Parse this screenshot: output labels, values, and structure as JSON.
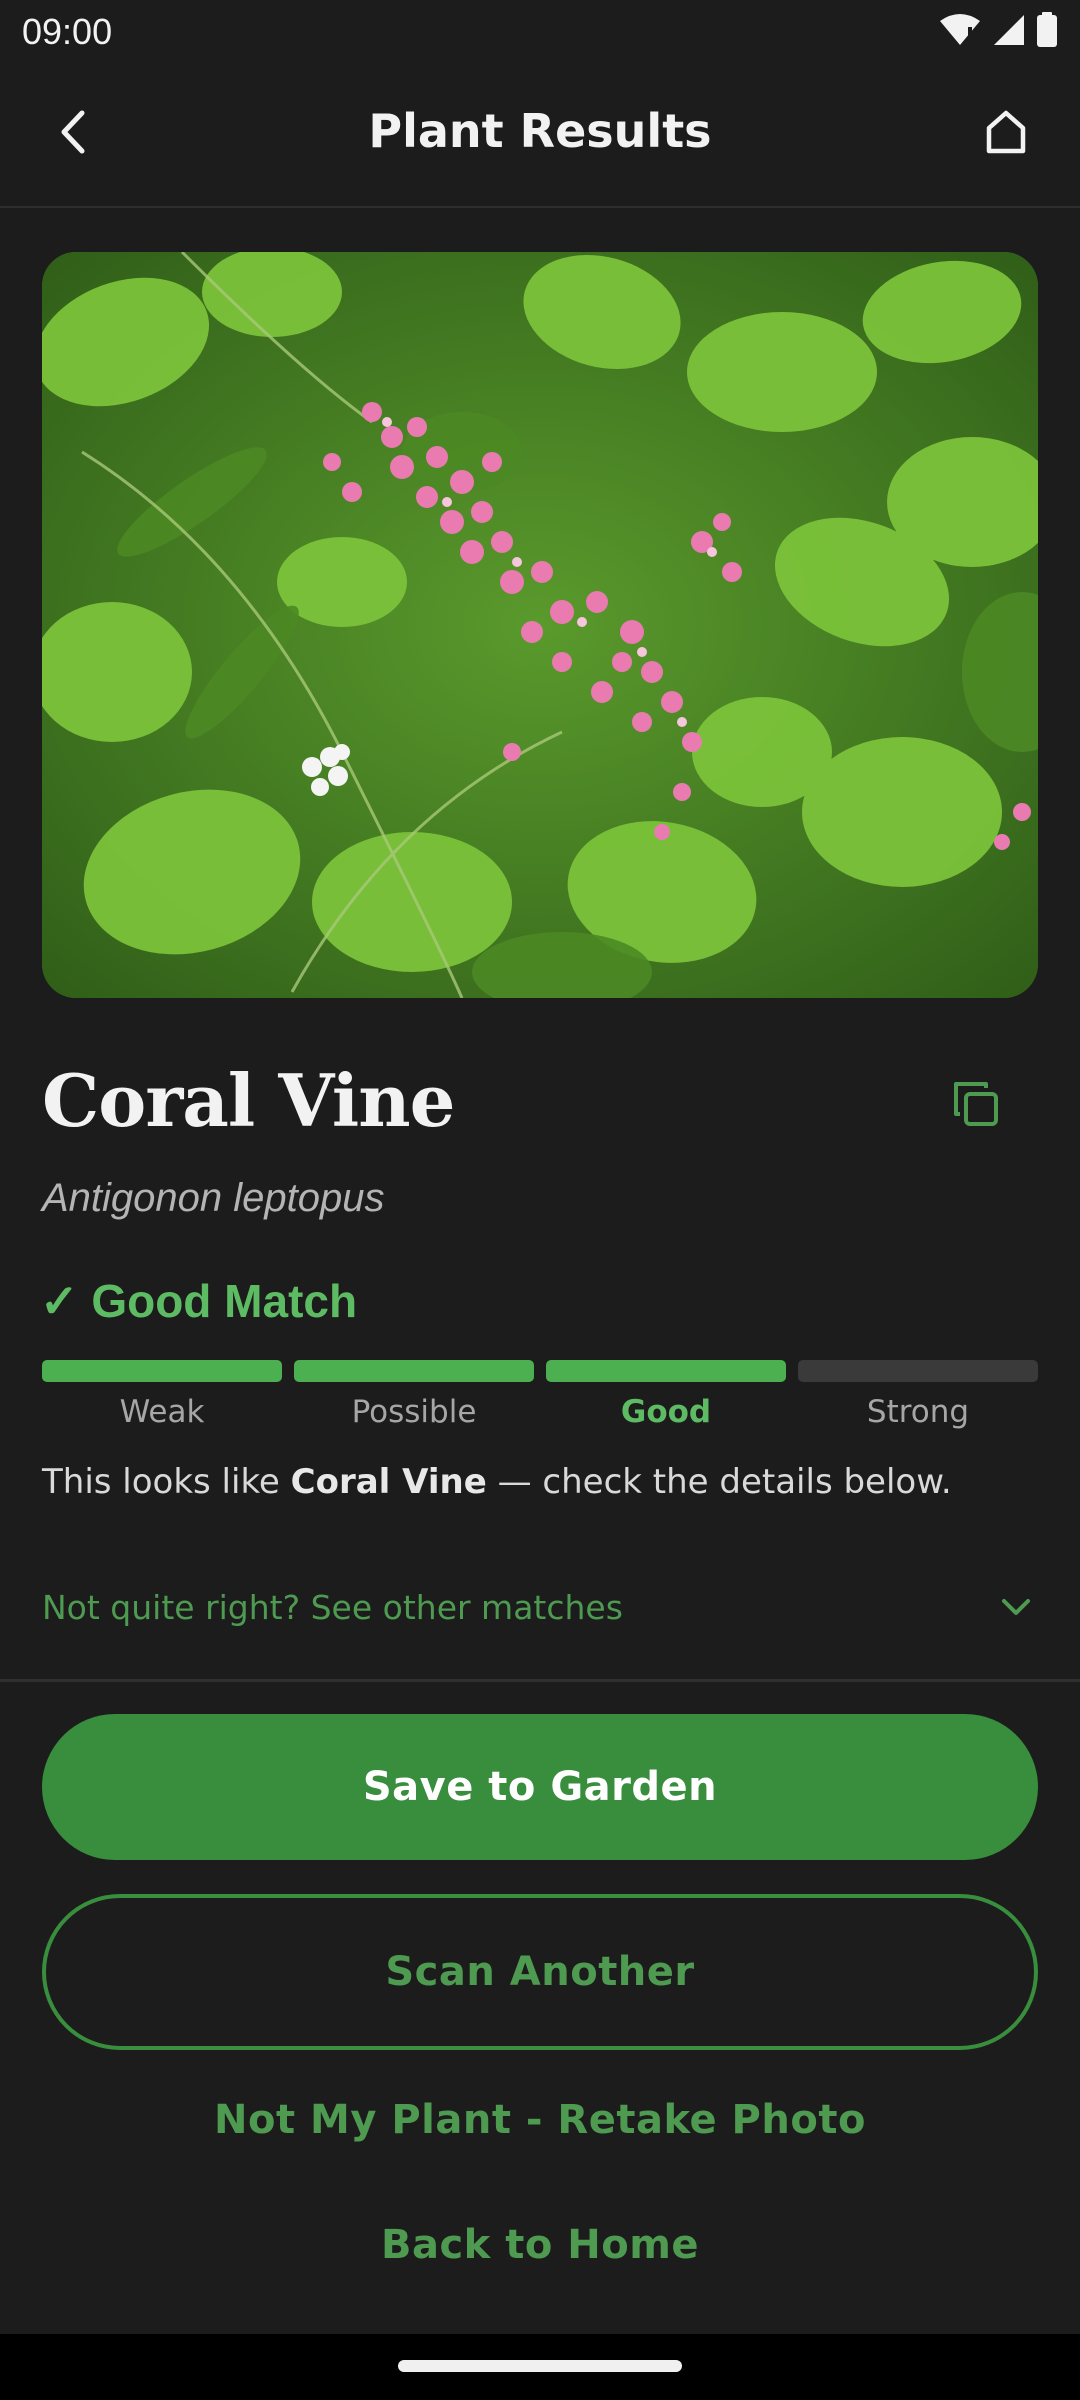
{
  "status_bar": {
    "time": "09:00",
    "icons": [
      "wifi-icon",
      "cell-signal-icon",
      "battery-icon"
    ]
  },
  "app_bar": {
    "title": "Plant Results",
    "back_icon": "chevron-left-icon",
    "home_icon": "home-icon"
  },
  "plant": {
    "common_name": "Coral Vine",
    "scientific_name": "Antigonon leptopus",
    "copy_icon": "copy-icon"
  },
  "match": {
    "label": "✓ Good Match",
    "level": 3,
    "levels": [
      "Weak",
      "Possible",
      "Good",
      "Strong"
    ],
    "active_index": 2,
    "description_before": "This looks like ",
    "description_name": "Coral Vine",
    "description_after": " — check the details below."
  },
  "other_matches": {
    "label": "Not quite right? See other matches",
    "icon": "chevron-down-icon"
  },
  "actions": {
    "save_label": "Save to Garden",
    "scan_label": "Scan Another",
    "retake_label": "Not My Plant - Retake Photo",
    "home_label": "Back to Home"
  },
  "colors": {
    "background": "#1c1c1c",
    "accent": "#388e3c",
    "accent_text": "#4e9a51",
    "match_green": "#5dbb63"
  }
}
